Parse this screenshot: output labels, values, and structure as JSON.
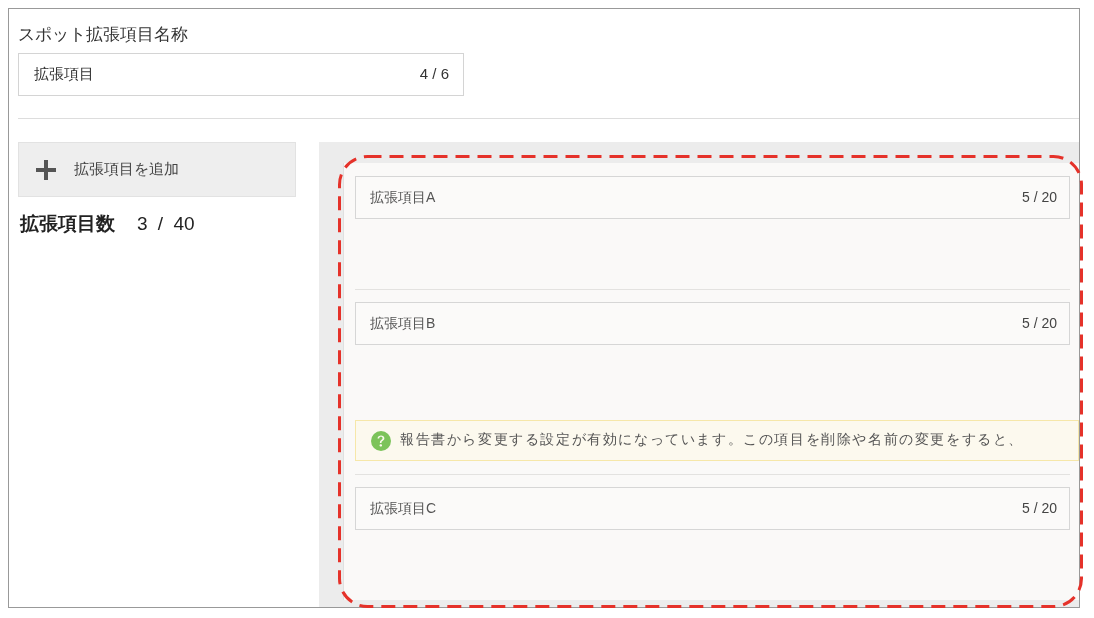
{
  "name_field": {
    "label": "スポット拡張項目名称",
    "value": "拡張項目",
    "counter": "4 / 6"
  },
  "add_button": {
    "label": "拡張項目を追加"
  },
  "item_count": {
    "label": "拡張項目数",
    "value": "3 / 40"
  },
  "items": [
    {
      "value": "拡張項目A",
      "counter": "5 / 20"
    },
    {
      "value": "拡張項目B",
      "counter": "5 / 20",
      "notice": "報告書から変更する設定が有効になっています。この項目を削除や名前の変更をすると、"
    },
    {
      "value": "拡張項目C",
      "counter": "5 / 20"
    }
  ]
}
